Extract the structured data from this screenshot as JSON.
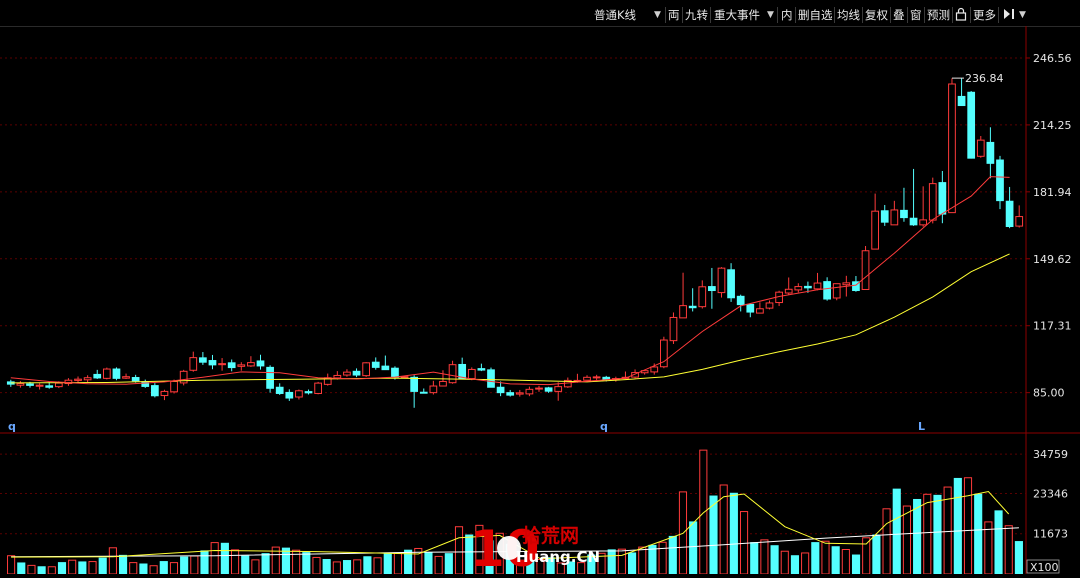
{
  "toolbar": {
    "kline_type": "普通K线",
    "items": [
      "両",
      "九转",
      "重大事件",
      "内",
      "删自选",
      "均线",
      "复权",
      "叠",
      "窗",
      "预测",
      "更多"
    ]
  },
  "markers": {
    "left": "q",
    "mid": "q",
    "right": "L"
  },
  "watermark": {
    "ten": "10",
    "brand": "拾荒网",
    "domain": "Huang.CN"
  },
  "colors": {
    "up": "#ff3b3b",
    "down": "#54ffff",
    "ma_short": "#ff3b3b",
    "ma_long": "#ffff33",
    "grid": "#5a0000",
    "axis": "#8b0000"
  },
  "chart_data": [
    {
      "type": "candlestick",
      "ylim": [
        66,
        262
      ],
      "yticks": [
        85.0,
        117.31,
        149.62,
        181.94,
        214.25,
        246.56
      ],
      "peak_label": "236.84",
      "peak_value": 236.84,
      "candles": [
        [
          90.2,
          89.1,
          91.2,
          87.8
        ],
        [
          88.6,
          89.4,
          90.6,
          87.4
        ],
        [
          89.2,
          88.5,
          90.2,
          87.4
        ],
        [
          88.1,
          88.6,
          89.5,
          86.5
        ],
        [
          88.3,
          87.6,
          90.3,
          86.9
        ],
        [
          87.9,
          89.6,
          90.5,
          87.2
        ],
        [
          89.4,
          91.0,
          92.0,
          88.3
        ],
        [
          90.9,
          91.5,
          92.8,
          89.5
        ],
        [
          91.2,
          92.2,
          93.4,
          90.0
        ],
        [
          93.8,
          92.1,
          96.0,
          91.6
        ],
        [
          91.9,
          96.4,
          97.1,
          91.4
        ],
        [
          96.4,
          91.9,
          97.2,
          91.0
        ],
        [
          92.0,
          92.7,
          94.2,
          91.6
        ],
        [
          92.3,
          90.7,
          93.6,
          89.8
        ],
        [
          90.3,
          88.0,
          91.3,
          87.3
        ],
        [
          88.4,
          83.5,
          89.6,
          82.7
        ],
        [
          83.6,
          85.6,
          86.4,
          81.4
        ],
        [
          85.4,
          90.4,
          91.3,
          84.6
        ],
        [
          89.7,
          95.3,
          96.0,
          88.5
        ],
        [
          95.8,
          101.9,
          104.8,
          95.1
        ],
        [
          101.8,
          99.7,
          104.6,
          98.4
        ],
        [
          100.5,
          98.4,
          103.2,
          96.3
        ],
        [
          98.5,
          99.0,
          101.7,
          95.6
        ],
        [
          99.4,
          97.1,
          101.0,
          95.3
        ],
        [
          97.7,
          98.4,
          99.7,
          95.6
        ],
        [
          97.9,
          99.5,
          102.6,
          97.4
        ],
        [
          100.3,
          97.9,
          103.3,
          96.1
        ],
        [
          97.2,
          87.1,
          98.2,
          85.0
        ],
        [
          87.6,
          84.6,
          89.5,
          83.9
        ],
        [
          85.1,
          82.4,
          86.6,
          81.0
        ],
        [
          82.9,
          85.9,
          86.5,
          81.7
        ],
        [
          85.5,
          84.9,
          86.5,
          84.1
        ],
        [
          84.6,
          89.6,
          90.2,
          84.2
        ],
        [
          89.0,
          92.2,
          94.2,
          88.4
        ],
        [
          92.1,
          93.3,
          95.4,
          91.3
        ],
        [
          93.5,
          94.9,
          96.3,
          92.7
        ],
        [
          95.3,
          93.5,
          96.7,
          92.5
        ],
        [
          93.2,
          99.4,
          99.7,
          92.6
        ],
        [
          99.7,
          97.2,
          102.0,
          96.1
        ],
        [
          97.8,
          96.1,
          102.9,
          96.0
        ],
        [
          96.8,
          92.5,
          97.7,
          91.3
        ],
        [
          92.5,
          92.7,
          93.2,
          91.9
        ],
        [
          92.4,
          85.6,
          93.4,
          77.7
        ],
        [
          85.2,
          84.9,
          87.0,
          84.7
        ],
        [
          85.0,
          88.2,
          90.7,
          84.1
        ],
        [
          88.2,
          90.4,
          95.8,
          88.2
        ],
        [
          89.8,
          98.5,
          100.4,
          89.3
        ],
        [
          98.6,
          91.7,
          101.9,
          91.4
        ],
        [
          91.8,
          96.2,
          97.2,
          91.0
        ],
        [
          96.6,
          95.9,
          99.0,
          95.4
        ],
        [
          96.0,
          87.6,
          97.1,
          87.6
        ],
        [
          87.6,
          85.0,
          90.4,
          83.3
        ],
        [
          85.0,
          83.8,
          86.3,
          83.1
        ],
        [
          84.3,
          84.9,
          86.3,
          83.1
        ],
        [
          84.4,
          86.6,
          87.9,
          83.3
        ],
        [
          86.9,
          87.2,
          88.3,
          85.4
        ],
        [
          87.3,
          85.7,
          87.8,
          84.9
        ],
        [
          85.6,
          87.9,
          90.0,
          81.1
        ],
        [
          87.8,
          90.9,
          92.3,
          87.3
        ],
        [
          90.9,
          90.9,
          94.1,
          89.8
        ],
        [
          91.0,
          92.4,
          93.4,
          91.0
        ],
        [
          92.2,
          92.6,
          93.6,
          90.7
        ],
        [
          92.4,
          91.4,
          93.1,
          90.4
        ],
        [
          91.3,
          91.8,
          92.7,
          90.3
        ],
        [
          91.9,
          92.4,
          95.2,
          91.6
        ],
        [
          92.5,
          94.7,
          96.2,
          91.9
        ],
        [
          94.6,
          95.6,
          96.0,
          93.7
        ],
        [
          95.0,
          97.4,
          99.1,
          93.7
        ],
        [
          97.5,
          110.4,
          112.0,
          96.8
        ],
        [
          110.1,
          121.3,
          123.7,
          108.5
        ],
        [
          121.1,
          127.0,
          142.9,
          126.3
        ],
        [
          126.7,
          126.0,
          135.4,
          124.2
        ],
        [
          126.5,
          136.1,
          139.2,
          125.6
        ],
        [
          136.2,
          134.3,
          145.2,
          125.5
        ],
        [
          133.3,
          145.1,
          145.6,
          130.9
        ],
        [
          144.3,
          130.8,
          147.5,
          128.8
        ],
        [
          131.5,
          127.5,
          132.3,
          124.2
        ],
        [
          127.6,
          123.9,
          128.2,
          121.4
        ],
        [
          123.4,
          125.5,
          128.6,
          123.7
        ],
        [
          125.8,
          128.3,
          129.5,
          125.2
        ],
        [
          128.5,
          133.5,
          134.2,
          126.8
        ],
        [
          133.1,
          134.9,
          140.6,
          132.2
        ],
        [
          134.6,
          136.2,
          137.8,
          133.4
        ],
        [
          136.3,
          135.6,
          138.6,
          133.2
        ],
        [
          135.1,
          137.9,
          142.8,
          134.4
        ],
        [
          138.6,
          130.2,
          140.7,
          129.4
        ],
        [
          130.7,
          137.6,
          137.1,
          129.6
        ],
        [
          137.1,
          138.0,
          141.4,
          131.4
        ],
        [
          138.5,
          134.3,
          141.3,
          133.7
        ],
        [
          134.8,
          153.5,
          155.8,
          135.8
        ],
        [
          154.3,
          172.6,
          181.1,
          154.6
        ],
        [
          172.8,
          167.3,
          175.6,
          165.5
        ],
        [
          166.0,
          173.2,
          177.6,
          169.0
        ],
        [
          173.0,
          169.5,
          183.9,
          167.5
        ],
        [
          169.2,
          166.0,
          193.0,
          165.5
        ],
        [
          166.0,
          168.4,
          184.6,
          165.1
        ],
        [
          168.3,
          185.9,
          188.8,
          166.7
        ],
        [
          186.4,
          171.2,
          192.0,
          166.8
        ],
        [
          171.9,
          234.0,
          236.8,
          173.6
        ],
        [
          228.0,
          223.6,
          236.8,
          223.7
        ],
        [
          230.0,
          198.2,
          230.6,
          198.0
        ],
        [
          199.1,
          206.9,
          208.9,
          198.4
        ],
        [
          205.8,
          195.7,
          213.1,
          188.5
        ],
        [
          197.3,
          177.7,
          199.3,
          173.6
        ],
        [
          177.4,
          165.2,
          184.3,
          164.4
        ],
        [
          165.4,
          170.0,
          175.4,
          164.7
        ]
      ],
      "ma_short": [
        [
          0,
          92.2
        ],
        [
          4,
          90.4
        ],
        [
          8,
          89.3
        ],
        [
          12,
          89.1
        ],
        [
          16,
          90.2
        ],
        [
          20,
          92.4
        ],
        [
          24,
          95.0
        ],
        [
          28,
          94.6
        ],
        [
          32,
          92.2
        ],
        [
          36,
          91.6
        ],
        [
          40,
          92.5
        ],
        [
          44,
          94.9
        ],
        [
          48,
          91.6
        ],
        [
          52,
          89.2
        ],
        [
          56,
          88.9
        ],
        [
          60,
          90.5
        ],
        [
          64,
          91.9
        ],
        [
          68,
          100.0
        ],
        [
          72,
          114.5
        ],
        [
          76,
          126.9
        ],
        [
          80,
          131.4
        ],
        [
          84,
          134.7
        ],
        [
          88,
          136.9
        ],
        [
          92,
          152.3
        ],
        [
          96,
          168.6
        ],
        [
          100,
          179.9
        ],
        [
          102,
          189.3
        ],
        [
          104,
          188.9
        ]
      ],
      "ma_long": [
        [
          0,
          89.7
        ],
        [
          10,
          89.9
        ],
        [
          20,
          91.0
        ],
        [
          30,
          91.5
        ],
        [
          40,
          92.0
        ],
        [
          50,
          91.3
        ],
        [
          60,
          90.2
        ],
        [
          64,
          91.3
        ],
        [
          68,
          92.6
        ],
        [
          72,
          96.2
        ],
        [
          76,
          100.7
        ],
        [
          80,
          104.7
        ],
        [
          84,
          108.5
        ],
        [
          88,
          112.9
        ],
        [
          92,
          121.4
        ],
        [
          96,
          131.2
        ],
        [
          100,
          143.4
        ],
        [
          104,
          152.0
        ]
      ]
    },
    {
      "type": "bar",
      "title": "",
      "ylim": [
        0,
        40000
      ],
      "yticks": [
        11673,
        23346,
        34759
      ],
      "unit_label": "X100",
      "volumes": [
        [
          5300,
          1
        ],
        [
          3200,
          0
        ],
        [
          2500,
          1
        ],
        [
          2100,
          0
        ],
        [
          2100,
          1
        ],
        [
          3300,
          0
        ],
        [
          4000,
          1
        ],
        [
          3500,
          0
        ],
        [
          3600,
          1
        ],
        [
          4600,
          0
        ],
        [
          7600,
          1
        ],
        [
          5400,
          0
        ],
        [
          3300,
          1
        ],
        [
          2900,
          0
        ],
        [
          2400,
          1
        ],
        [
          3600,
          0
        ],
        [
          3300,
          1
        ],
        [
          4900,
          0
        ],
        [
          5200,
          1
        ],
        [
          6700,
          0
        ],
        [
          9100,
          1
        ],
        [
          8900,
          0
        ],
        [
          7000,
          1
        ],
        [
          5200,
          0
        ],
        [
          4100,
          1
        ],
        [
          5900,
          0
        ],
        [
          7800,
          1
        ],
        [
          7500,
          0
        ],
        [
          6900,
          1
        ],
        [
          6200,
          0
        ],
        [
          4800,
          1
        ],
        [
          4200,
          0
        ],
        [
          3500,
          1
        ],
        [
          3900,
          0
        ],
        [
          4100,
          1
        ],
        [
          5000,
          0
        ],
        [
          4700,
          1
        ],
        [
          5800,
          0
        ],
        [
          6000,
          1
        ],
        [
          6900,
          0
        ],
        [
          7400,
          1
        ],
        [
          6200,
          0
        ],
        [
          5100,
          1
        ],
        [
          5900,
          0
        ],
        [
          13700,
          1
        ],
        [
          11300,
          0
        ],
        [
          14100,
          1
        ],
        [
          9600,
          0
        ],
        [
          11800,
          1
        ],
        [
          8600,
          0
        ],
        [
          4000,
          1
        ],
        [
          3800,
          0
        ],
        [
          4200,
          1
        ],
        [
          4700,
          0
        ],
        [
          3200,
          1
        ],
        [
          3500,
          0
        ],
        [
          3300,
          1
        ],
        [
          5500,
          0
        ],
        [
          6000,
          1
        ],
        [
          7000,
          0
        ],
        [
          7200,
          1
        ],
        [
          6100,
          0
        ],
        [
          7800,
          1
        ],
        [
          8300,
          0
        ],
        [
          9200,
          1
        ],
        [
          10900,
          0
        ],
        [
          23800,
          1
        ],
        [
          15100,
          0
        ],
        [
          35900,
          1
        ],
        [
          22600,
          0
        ],
        [
          25800,
          1
        ],
        [
          23400,
          0
        ],
        [
          18100,
          1
        ],
        [
          9100,
          0
        ],
        [
          9900,
          1
        ],
        [
          8200,
          0
        ],
        [
          6600,
          1
        ],
        [
          5300,
          0
        ],
        [
          6100,
          1
        ],
        [
          9100,
          0
        ],
        [
          9500,
          1
        ],
        [
          7900,
          0
        ],
        [
          7100,
          1
        ],
        [
          5500,
          0
        ],
        [
          10500,
          1
        ],
        [
          11300,
          0
        ],
        [
          18900,
          1
        ],
        [
          24600,
          0
        ],
        [
          19700,
          1
        ],
        [
          21600,
          0
        ],
        [
          23100,
          1
        ],
        [
          22800,
          0
        ],
        [
          25200,
          1
        ],
        [
          27700,
          0
        ],
        [
          27900,
          1
        ],
        [
          23100,
          0
        ],
        [
          15100,
          1
        ],
        [
          18300,
          0
        ],
        [
          14000,
          1
        ],
        [
          9400,
          0
        ]
      ],
      "vol_ma_short": [
        [
          0,
          4900
        ],
        [
          10,
          5000
        ],
        [
          20,
          6800
        ],
        [
          30,
          6500
        ],
        [
          40,
          5800
        ],
        [
          44,
          10500
        ],
        [
          48,
          11200
        ],
        [
          52,
          4400
        ],
        [
          60,
          5400
        ],
        [
          66,
          11800
        ],
        [
          68,
          17700
        ],
        [
          70,
          22400
        ],
        [
          72,
          23200
        ],
        [
          76,
          13700
        ],
        [
          80,
          8900
        ],
        [
          84,
          8700
        ],
        [
          86,
          14600
        ],
        [
          90,
          20700
        ],
        [
          94,
          22700
        ],
        [
          96,
          23900
        ],
        [
          98,
          17400
        ]
      ],
      "vol_ma_long": [
        [
          0,
          5000
        ],
        [
          20,
          5300
        ],
        [
          40,
          6300
        ],
        [
          60,
          6700
        ],
        [
          70,
          8500
        ],
        [
          80,
          10400
        ],
        [
          90,
          12000
        ],
        [
          99,
          13400
        ]
      ]
    }
  ]
}
